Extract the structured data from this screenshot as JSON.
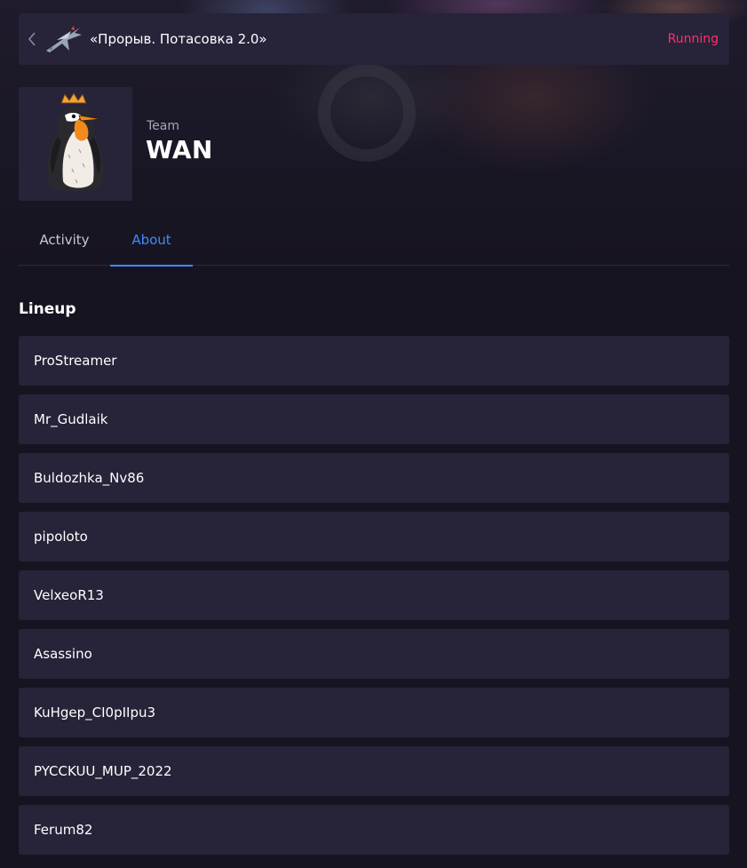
{
  "header": {
    "back_icon": "chevron-left-icon",
    "tournament_logo": "plane-logo-icon",
    "tournament_title": "«Прорыв. Потасовка 2.0»",
    "status": "Running",
    "status_color": "#ff2f6e"
  },
  "team": {
    "label": "Team",
    "name": "WAN",
    "avatar": "crowned-penguin-logo"
  },
  "tabs": [
    {
      "label": "Activity",
      "active": false
    },
    {
      "label": "About",
      "active": true
    }
  ],
  "accent_color": "#3e8bff",
  "lineup": {
    "title": "Lineup",
    "players": [
      "ProStreamer",
      "Mr_Gudlaik",
      "Buldozhka_Nv86",
      "pipoloto",
      "VelxeoR13",
      "Asassino",
      "KuHgep_CI0pIIpu3",
      "PYCCKUU_MUP_2022",
      "Ferum82"
    ]
  }
}
